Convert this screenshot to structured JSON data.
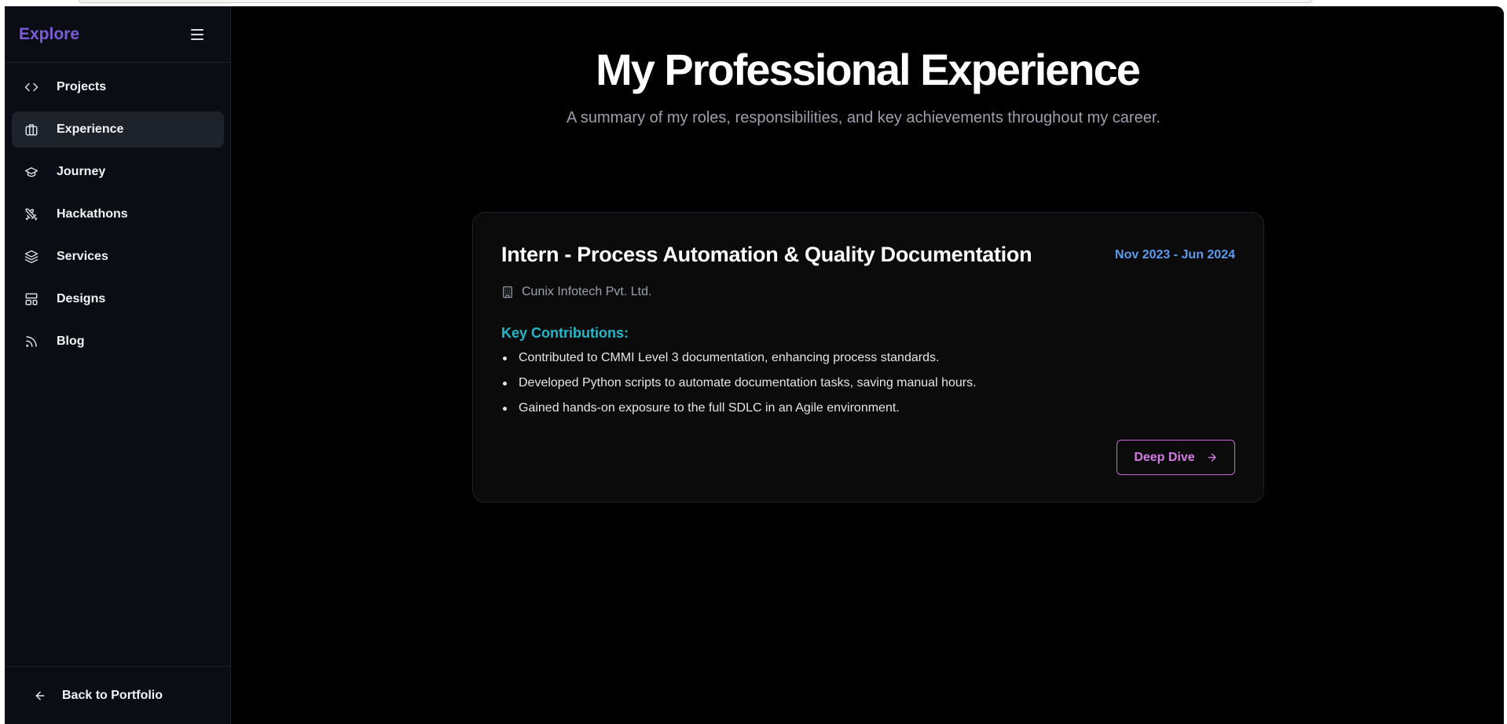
{
  "sidebar": {
    "title": "Explore",
    "items": [
      {
        "label": "Projects",
        "icon": "code-icon",
        "active": false
      },
      {
        "label": "Experience",
        "icon": "briefcase-icon",
        "active": true
      },
      {
        "label": "Journey",
        "icon": "graduation-cap-icon",
        "active": false
      },
      {
        "label": "Hackathons",
        "icon": "swords-icon",
        "active": false
      },
      {
        "label": "Services",
        "icon": "layers-icon",
        "active": false
      },
      {
        "label": "Designs",
        "icon": "layout-icon",
        "active": false
      },
      {
        "label": "Blog",
        "icon": "rss-icon",
        "active": false
      }
    ],
    "footer_label": "Back to Portfolio"
  },
  "main": {
    "title": "My Professional Experience",
    "subtitle": "A summary of my roles, responsibilities, and key achievements throughout my career."
  },
  "experience": {
    "role": "Intern - Process Automation & Quality Documentation",
    "dates": "Nov 2023 - Jun 2024",
    "company": "Cunix Infotech Pvt. Ltd.",
    "contributions_title": "Key Contributions:",
    "contributions": [
      "Contributed to CMMI Level 3 documentation, enhancing process standards.",
      "Developed Python scripts to automate documentation tasks, saving manual hours.",
      "Gained hands-on exposure to the full SDLC in an Agile environment."
    ],
    "button_label": "Deep Dive"
  },
  "colors": {
    "accent_purple": "#7c5cd6",
    "dates_blue": "#5b9cf0",
    "contributions_cyan": "#22b8c9",
    "button_pink": "#d77be6"
  }
}
